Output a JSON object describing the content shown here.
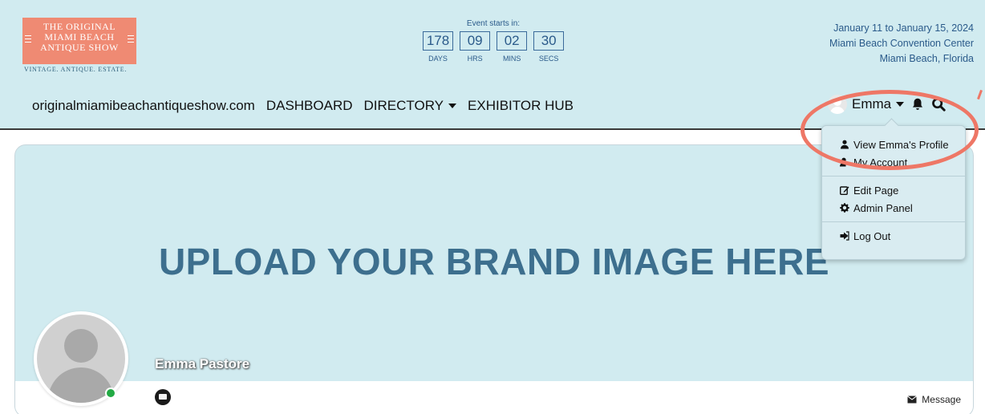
{
  "logo": {
    "lines": [
      "THE ORIGINAL",
      "MIAMI BEACH",
      "ANTIQUE SHOW"
    ],
    "tagline": "VINTAGE. ANTIQUE. ESTATE.",
    "bg_color": "#ef8a73"
  },
  "countdown": {
    "label": "Event starts in:",
    "units": [
      {
        "value": "178",
        "label": "DAYS"
      },
      {
        "value": "09",
        "label": "HRS"
      },
      {
        "value": "02",
        "label": "MINS"
      },
      {
        "value": "30",
        "label": "SECS"
      }
    ]
  },
  "event_info": {
    "dates": "January 11 to January 15, 2024",
    "venue": "Miami Beach Convention Center",
    "city": "Miami Beach, Florida"
  },
  "nav": {
    "site": "originalmiamibeachantiqueshow.com",
    "dashboard": "DASHBOARD",
    "directory": "DIRECTORY",
    "exhibitor_hub": "EXHIBITOR HUB"
  },
  "user": {
    "name": "Emma",
    "icons": [
      "avatar",
      "caret-down-icon",
      "bell-icon",
      "search-icon"
    ]
  },
  "dropdown": {
    "view_profile": "View Emma's Profile",
    "my_account": "My Account",
    "edit_page": "Edit Page",
    "admin_panel": "Admin Panel",
    "log_out": "Log Out"
  },
  "profile": {
    "banner_text": "UPLOAD YOUR BRAND IMAGE HERE",
    "full_name": "Emma Pastore",
    "status": "online",
    "message_label": "Message"
  },
  "colors": {
    "header_bg": "#d1ebf0",
    "accent_text": "#2a5a8a",
    "banner_text": "#3d6f8e",
    "annotation": "#ee7766",
    "online": "#22aa44"
  }
}
